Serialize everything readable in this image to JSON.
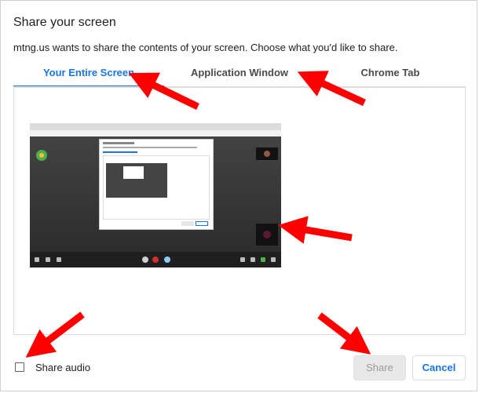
{
  "dialog": {
    "title": "Share your screen",
    "subtitle": "mtng.us wants to share the contents of your screen. Choose what you'd like to share."
  },
  "tabs": [
    {
      "label": "Your Entire Screen",
      "active": true
    },
    {
      "label": "Application Window",
      "active": false
    },
    {
      "label": "Chrome Tab",
      "active": false
    }
  ],
  "footer": {
    "share_audio_label": "Share audio",
    "share_audio_checked": false,
    "share_button": "Share",
    "share_enabled": false,
    "cancel_button": "Cancel"
  },
  "colors": {
    "accent": "#1a73e8",
    "annotation_arrow": "#ff0000",
    "disabled_button_bg": "#e8e8e8"
  }
}
